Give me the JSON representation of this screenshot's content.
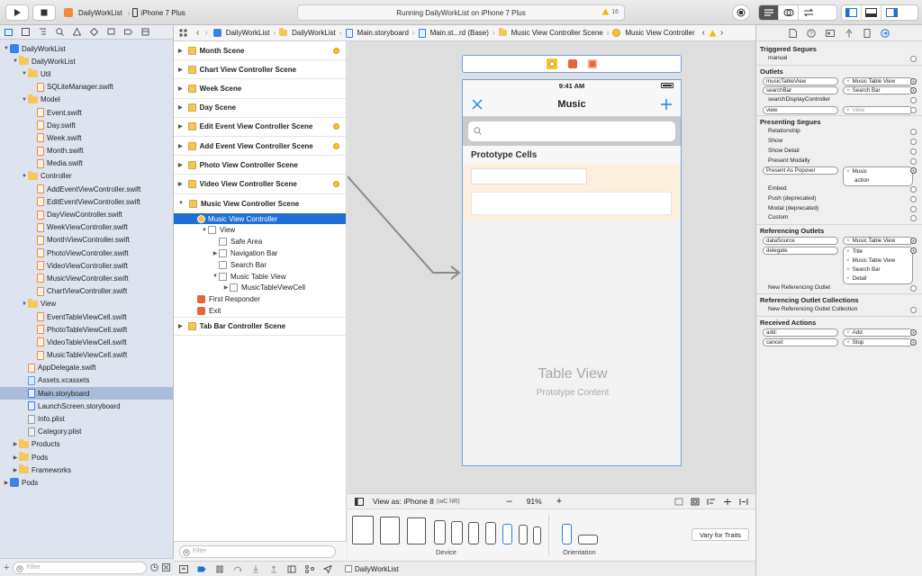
{
  "toolbar": {
    "scheme": "DailyWorkList",
    "device": "iPhone 7 Plus",
    "status": "Running DailyWorkList on iPhone 7 Plus",
    "warnings": "16"
  },
  "navigator": {
    "items": [
      {
        "label": "DailyWorkList",
        "type": "proj",
        "depth": 0,
        "open": true
      },
      {
        "label": "DailyWorkList",
        "type": "folder",
        "depth": 1,
        "open": true
      },
      {
        "label": "Util",
        "type": "folder",
        "depth": 2,
        "open": true
      },
      {
        "label": "SQLiteManager.swift",
        "type": "swift",
        "depth": 3
      },
      {
        "label": "Model",
        "type": "folder",
        "depth": 2,
        "open": true
      },
      {
        "label": "Event.swift",
        "type": "swift",
        "depth": 3
      },
      {
        "label": "Day.swift",
        "type": "swift",
        "depth": 3
      },
      {
        "label": "Week.swift",
        "type": "swift",
        "depth": 3
      },
      {
        "label": "Month.swift",
        "type": "swift",
        "depth": 3
      },
      {
        "label": "Media.swift",
        "type": "swift",
        "depth": 3
      },
      {
        "label": "Controller",
        "type": "folder",
        "depth": 2,
        "open": true
      },
      {
        "label": "AddEventViewController.swift",
        "type": "swift",
        "depth": 3
      },
      {
        "label": "EditEventViewController.swift",
        "type": "swift",
        "depth": 3
      },
      {
        "label": "DayViewController.swift",
        "type": "swift",
        "depth": 3
      },
      {
        "label": "WeekViewController.swift",
        "type": "swift",
        "depth": 3
      },
      {
        "label": "MonthViewController.swift",
        "type": "swift",
        "depth": 3
      },
      {
        "label": "PhotoViewController.swift",
        "type": "swift",
        "depth": 3
      },
      {
        "label": "VideoViewController.swift",
        "type": "swift",
        "depth": 3
      },
      {
        "label": "MusicViewController.swift",
        "type": "swift",
        "depth": 3
      },
      {
        "label": "ChartViewController.swift",
        "type": "swift",
        "depth": 3
      },
      {
        "label": "View",
        "type": "folder",
        "depth": 2,
        "open": true
      },
      {
        "label": "EventTableViewCell.swift",
        "type": "swift",
        "depth": 3
      },
      {
        "label": "PhotoTableViewCell.swift",
        "type": "swift",
        "depth": 3
      },
      {
        "label": "VideoTableViewCell.swift",
        "type": "swift",
        "depth": 3
      },
      {
        "label": "MusicTableViewCell.swift",
        "type": "swift",
        "depth": 3
      },
      {
        "label": "AppDelegate.swift",
        "type": "swift",
        "depth": 2
      },
      {
        "label": "Assets.xcassets",
        "type": "xc",
        "depth": 2
      },
      {
        "label": "Main.storyboard",
        "type": "sb",
        "depth": 2,
        "selected": true
      },
      {
        "label": "LaunchScreen.storyboard",
        "type": "sb",
        "depth": 2
      },
      {
        "label": "Info.plist",
        "type": "pl",
        "depth": 2
      },
      {
        "label": "Category.plist",
        "type": "pl",
        "depth": 2
      },
      {
        "label": "Products",
        "type": "folder",
        "depth": 1,
        "open": false
      },
      {
        "label": "Pods",
        "type": "folder",
        "depth": 1,
        "open": false
      },
      {
        "label": "Frameworks",
        "type": "folder",
        "depth": 1,
        "open": false
      },
      {
        "label": "Pods",
        "type": "proj",
        "depth": 0,
        "open": false
      }
    ],
    "filter_placeholder": "Filter"
  },
  "jumpbar": [
    "DailyWorkList",
    "DailyWorkList",
    "Main.storyboard",
    "Main.st...rd (Base)",
    "Music View Controller Scene",
    "Music View Controller"
  ],
  "outline": {
    "scenes": [
      {
        "label": "Month Scene",
        "dot": true
      },
      {
        "label": "Chart View Controller Scene",
        "dot": false
      },
      {
        "label": "Week Scene",
        "dot": false
      },
      {
        "label": "Day Scene",
        "dot": false
      },
      {
        "label": "Edit Event View Controller Scene",
        "dot": true
      },
      {
        "label": "Add Event View Controller Scene",
        "dot": true
      },
      {
        "label": "Photo View Controller Scene",
        "dot": false
      },
      {
        "label": "Video View Controller Scene",
        "dot": true
      },
      {
        "label": "Music View Controller Scene",
        "dot": false,
        "open": true
      }
    ],
    "children": [
      {
        "label": "Music View Controller",
        "depth": 1,
        "kind": "vc",
        "selected": true
      },
      {
        "label": "View",
        "depth": 2,
        "kind": "box",
        "open": true
      },
      {
        "label": "Safe Area",
        "depth": 3,
        "kind": "box"
      },
      {
        "label": "Navigation Bar",
        "depth": 3,
        "kind": "box",
        "closed": true
      },
      {
        "label": "Search Bar",
        "depth": 3,
        "kind": "box"
      },
      {
        "label": "Music Table View",
        "depth": 3,
        "kind": "box",
        "open": true
      },
      {
        "label": "MusicTableViewCell",
        "depth": 4,
        "kind": "box",
        "closed": true
      },
      {
        "label": "First Responder",
        "depth": 1,
        "kind": "fr"
      },
      {
        "label": "Exit",
        "depth": 1,
        "kind": "fr"
      }
    ],
    "last_scene": "Tab Bar Controller Scene",
    "filter_placeholder": "Filter"
  },
  "canvas": {
    "time": "9:41 AM",
    "nav_title": "Music",
    "prototype_header": "Prototype Cells",
    "table_view_label": "Table View",
    "prototype_content_label": "Prototype Content"
  },
  "viewas": {
    "label": "View as: iPhone 8",
    "traits": "(wC hR)",
    "zoom": "91%",
    "device_label": "Device",
    "orientation_label": "Orientation",
    "vary_label": "Vary for Traits"
  },
  "bottombar": {
    "crumb": "DailyWorkList"
  },
  "inspector": {
    "triggered_segues": {
      "title": "Triggered Segues",
      "rows": [
        "manual"
      ]
    },
    "outlets": {
      "title": "Outlets",
      "rows": [
        {
          "name": "musicTableView",
          "target": "Music Table View"
        },
        {
          "name": "searchBar",
          "target": "Search Bar"
        },
        {
          "name": "searchDisplayController",
          "target": ""
        },
        {
          "name": "view",
          "target": "View",
          "grey": true
        }
      ]
    },
    "presenting_segues": {
      "title": "Presenting Segues",
      "rows": [
        "Relationship",
        "Show",
        "Show Detail",
        "Present Modally",
        "Present As Popover",
        "Embed",
        "Push (deprecated)",
        "Modal (deprecated)",
        "Custom"
      ],
      "popover_target_line1": "Music",
      "popover_target_line2": "action"
    },
    "referencing_outlets": {
      "title": "Referencing Outlets",
      "datasource": {
        "name": "dataSource",
        "target": "Music Table View"
      },
      "delegate": {
        "name": "delegate",
        "targets": [
          "Title",
          "Music Table View",
          "Search Bar",
          "Detail"
        ]
      },
      "new": "New Referencing Outlet"
    },
    "referencing_collections": {
      "title": "Referencing Outlet Collections",
      "new": "New Referencing Outlet Collection"
    },
    "received_actions": {
      "title": "Received Actions",
      "rows": [
        {
          "name": "add:",
          "target": "Add"
        },
        {
          "name": "cancel:",
          "target": "Stop"
        }
      ]
    }
  }
}
